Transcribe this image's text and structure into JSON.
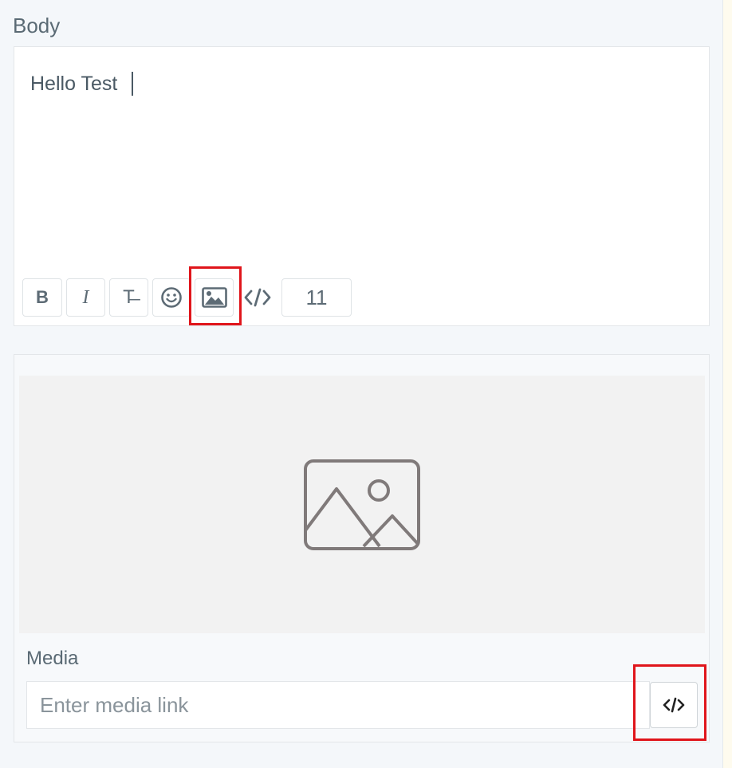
{
  "body": {
    "label": "Body",
    "text": "Hello Test"
  },
  "toolbar": {
    "bold_label": "B",
    "italic_label": "I",
    "strike_label": "T̶",
    "char_count": "11",
    "icons": [
      "bold-icon",
      "italic-icon",
      "strikethrough-icon",
      "emoji-icon",
      "image-icon",
      "code-icon"
    ]
  },
  "media": {
    "label": "Media",
    "placeholder": "Enter media link",
    "preview_icon": "image-placeholder-icon",
    "embed_icon": "code-icon"
  },
  "colors": {
    "highlight": "#e0151b",
    "text": "#4a5964",
    "preview_bg": "#f2f2f2"
  }
}
